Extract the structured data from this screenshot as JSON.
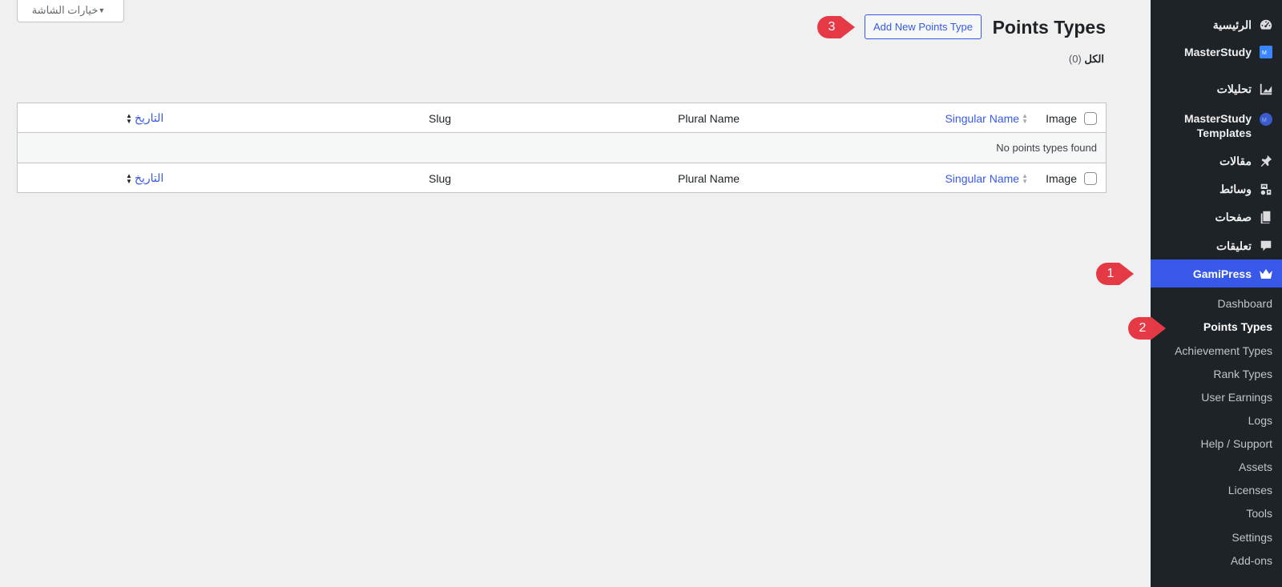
{
  "screen_options": {
    "label": "خيارات الشاشة"
  },
  "header": {
    "title": "Points Types",
    "add_new_label": "Add New Points Type"
  },
  "views": {
    "all_label": "الكل",
    "all_count": "(0)"
  },
  "table": {
    "columns": {
      "image": "Image",
      "singular": "Singular Name",
      "plural": "Plural Name",
      "slug": "Slug",
      "date": "التاريخ"
    },
    "empty_message": "No points types found"
  },
  "sidebar": {
    "menu": [
      {
        "label": "الرئيسية",
        "icon": "dashboard-gauge-icon"
      },
      {
        "label": "MasterStudy",
        "icon": "masterstudy-logo-icon"
      },
      {
        "label": "تحليلات",
        "icon": "analytics-chart-icon"
      },
      {
        "label": "MasterStudy Templates",
        "icon": "masterstudy-templates-icon"
      },
      {
        "label": "مقالات",
        "icon": "pin-icon"
      },
      {
        "label": "وسائط",
        "icon": "media-icon"
      },
      {
        "label": "صفحات",
        "icon": "pages-icon"
      },
      {
        "label": "تعليقات",
        "icon": "comment-bubble-icon"
      },
      {
        "label": "GamiPress",
        "icon": "crown-icon"
      }
    ],
    "submenu": [
      "Dashboard",
      "Points Types",
      "Achievement Types",
      "Rank Types",
      "User Earnings",
      "Logs",
      "Help / Support",
      "Assets",
      "Licenses",
      "Tools",
      "Settings",
      "Add-ons"
    ]
  },
  "callouts": [
    "1",
    "2",
    "3"
  ],
  "colors": {
    "accent": "#3858e9",
    "callout": "#e63946",
    "sidebar_bg": "#1d2327"
  }
}
